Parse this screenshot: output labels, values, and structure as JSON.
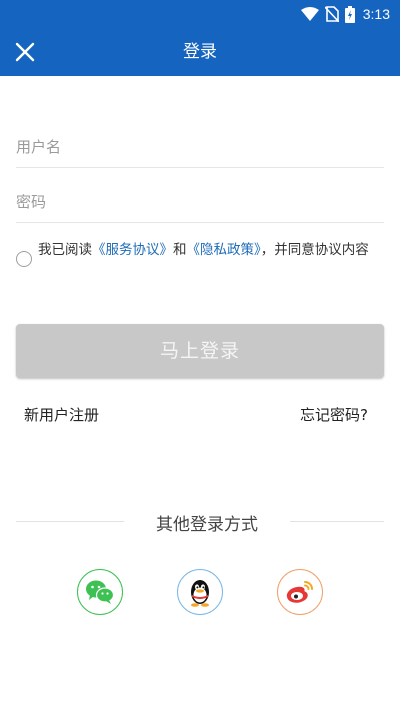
{
  "status_bar": {
    "time": "3:13",
    "icons": [
      "wifi-icon",
      "no-sim-icon",
      "battery-icon"
    ]
  },
  "app_bar": {
    "title": "登录",
    "close_icon": "close-icon"
  },
  "form": {
    "username_placeholder": "用户名",
    "username_value": "",
    "password_placeholder": "密码",
    "password_value": ""
  },
  "agreement": {
    "prefix": "我已阅读",
    "service_link": "《服务协议》",
    "and": "和",
    "privacy_link": "《隐私政策》",
    "suffix": "，并同意协议内容",
    "checked": false
  },
  "login_button": "马上登录",
  "links": {
    "register": "新用户注册",
    "forgot_password": "忘记密码?"
  },
  "other_login": {
    "title": "其他登录方式",
    "options": [
      "wechat-icon",
      "qq-icon",
      "weibo-icon"
    ]
  },
  "colors": {
    "primary": "#1565c0",
    "link": "#1e6bb8",
    "button_disabled": "#c8c8c8",
    "wechat": "#3cc152",
    "qq": "#7ab8e8",
    "weibo": "#f0a06a"
  }
}
